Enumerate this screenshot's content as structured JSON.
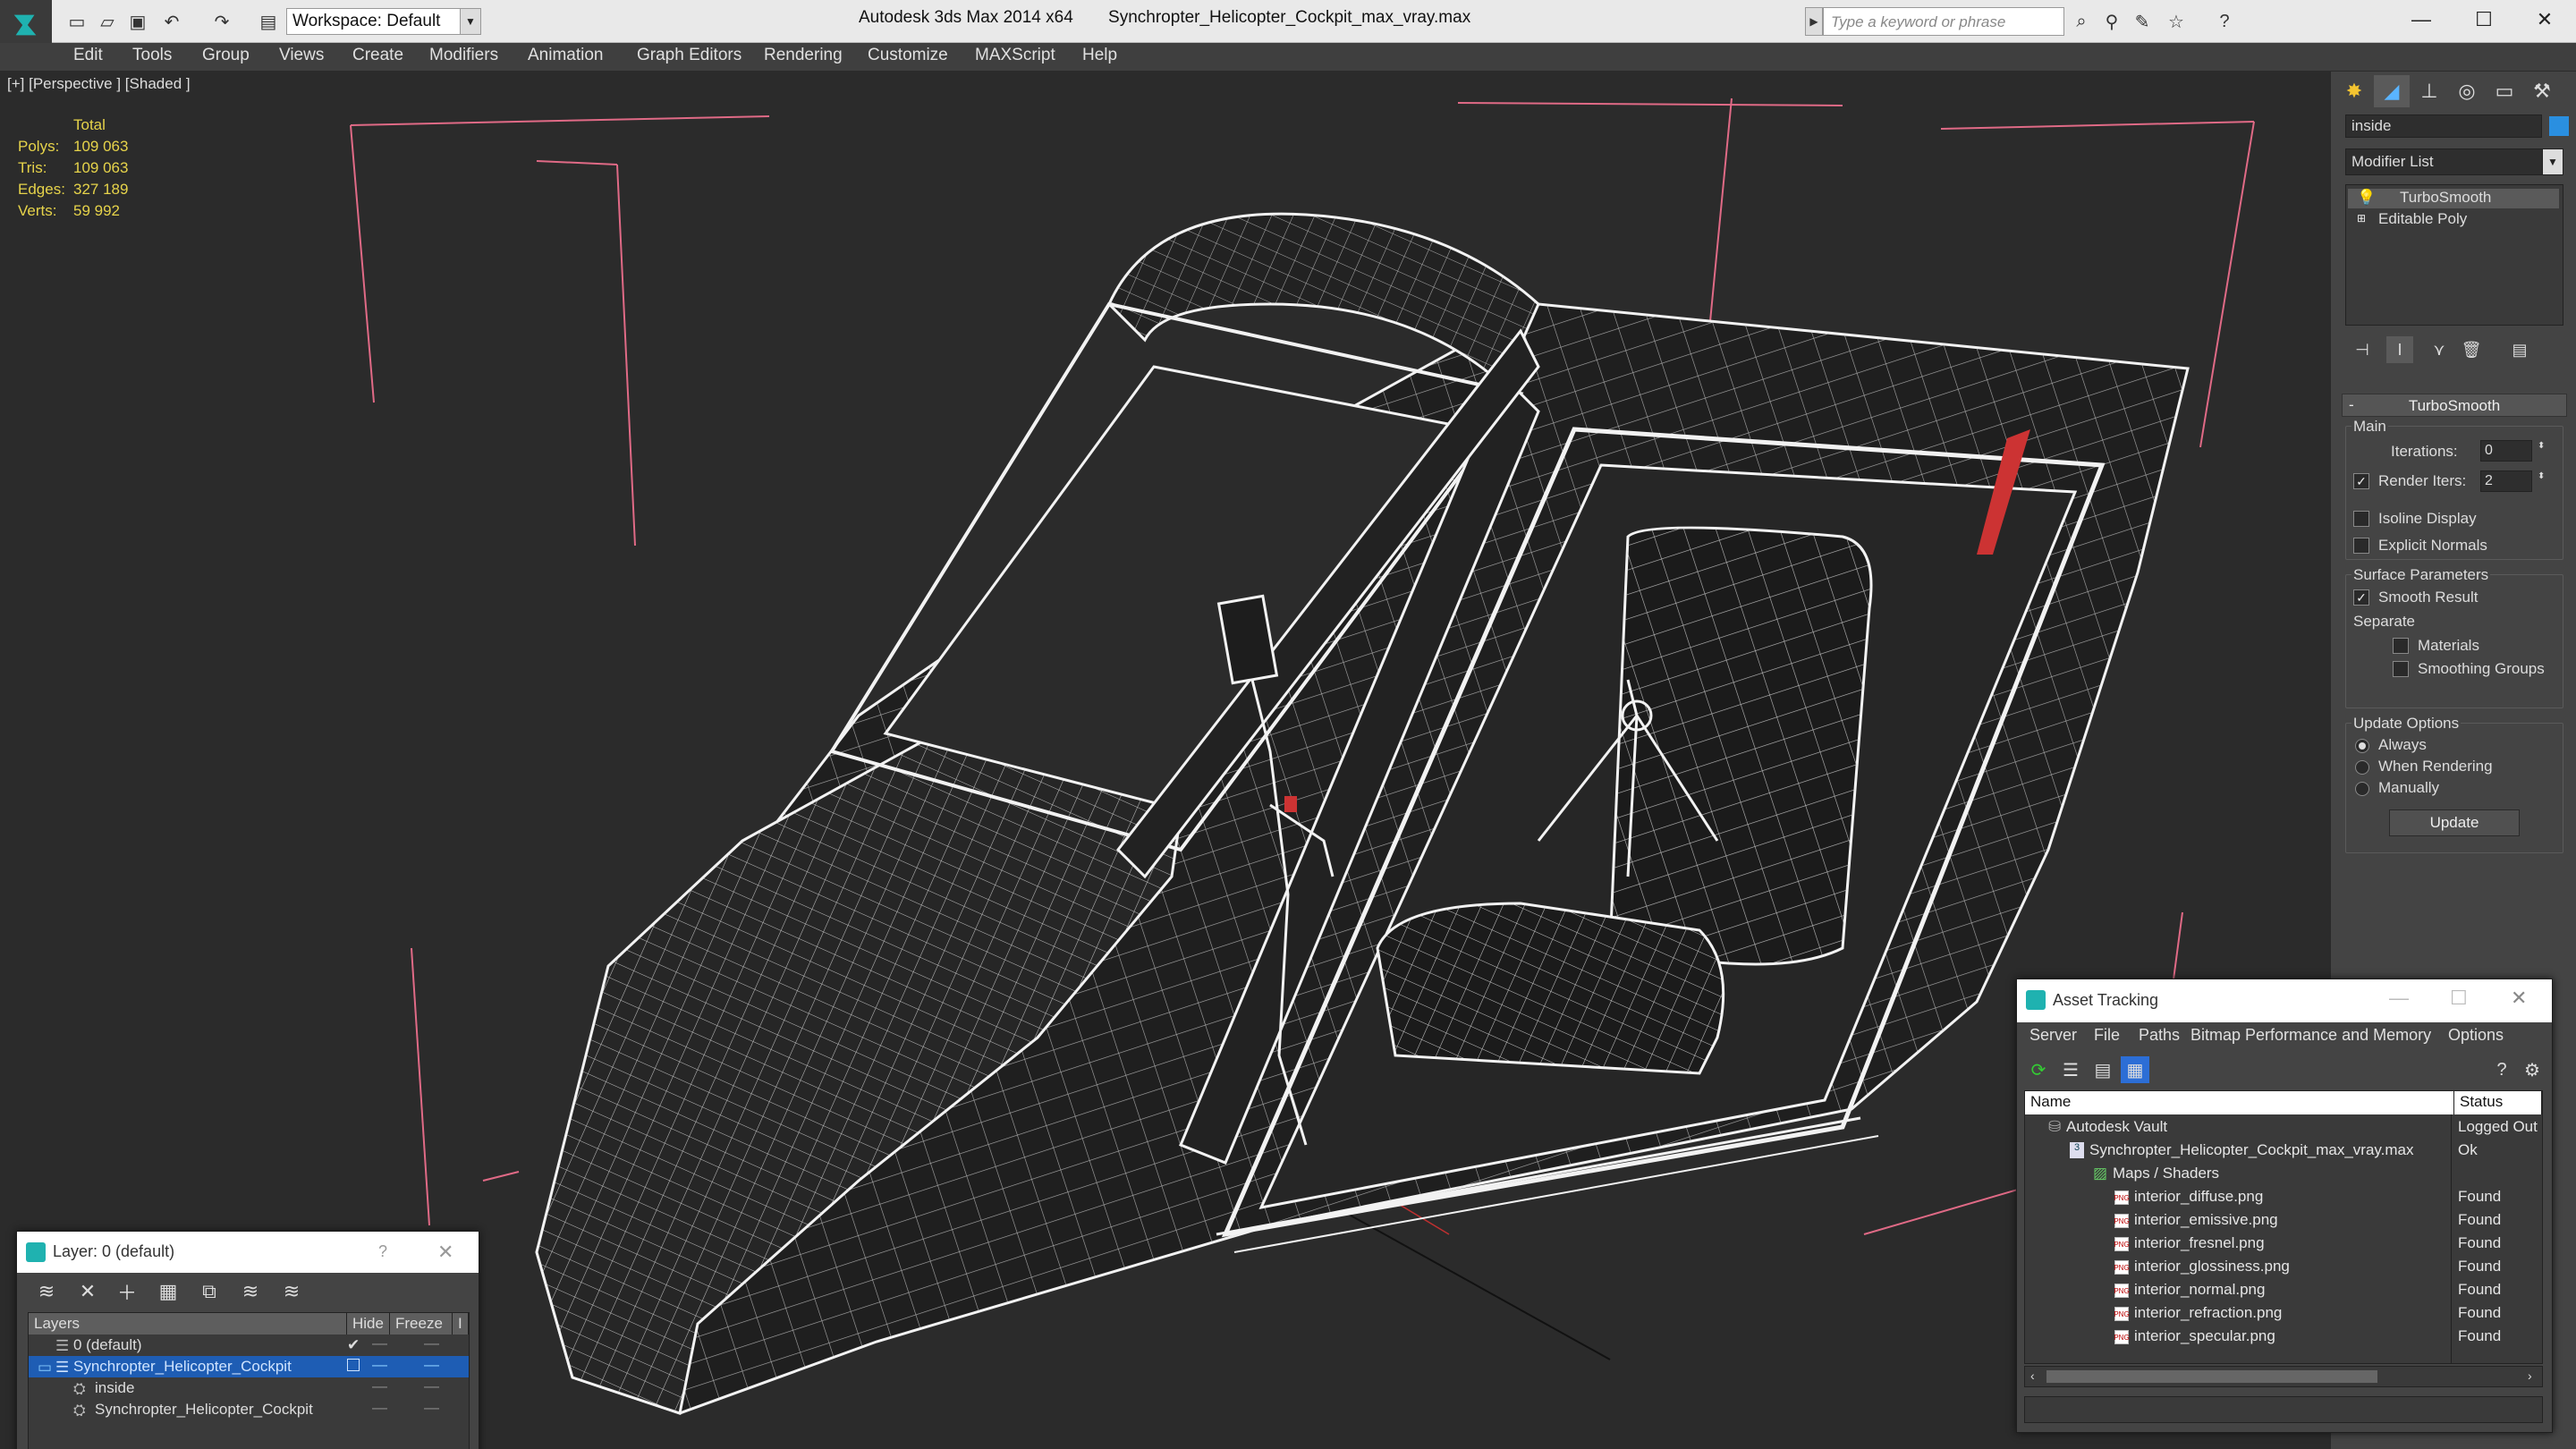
{
  "titlebar": {
    "workspace": "Workspace: Default",
    "app_title": "Autodesk 3ds Max  2014 x64",
    "file_title": "Synchropter_Helicopter_Cockpit_max_vray.max",
    "search_placeholder": "Type a keyword or phrase"
  },
  "menu": [
    "Edit",
    "Tools",
    "Group",
    "Views",
    "Create",
    "Modifiers",
    "Animation",
    "Graph Editors",
    "Rendering",
    "Customize",
    "MAXScript",
    "Help"
  ],
  "viewport": {
    "label": "[+] [Perspective ] [Shaded ]",
    "stats": {
      "header": "Total",
      "rows": [
        {
          "k": "Polys:",
          "v": "109 063"
        },
        {
          "k": "Tris:",
          "v": "109 063"
        },
        {
          "k": "Edges:",
          "v": "327 189"
        },
        {
          "k": "Verts:",
          "v": "59 992"
        }
      ]
    }
  },
  "command_panel": {
    "object_name": "inside",
    "modifier_list": "Modifier List",
    "stack": [
      "TurboSmooth",
      "Editable Poly"
    ],
    "turbosmooth": {
      "title": "TurboSmooth",
      "main": "Main",
      "iterations_label": "Iterations:",
      "iterations": "0",
      "render_iters_label": "Render Iters:",
      "render_iters": "2",
      "isoline": "Isoline Display",
      "explicit_normals": "Explicit Normals",
      "surface_params": "Surface Parameters",
      "smooth_result": "Smooth Result",
      "separate": "Separate",
      "materials": "Materials",
      "smoothing_groups": "Smoothing Groups",
      "update_options": "Update Options",
      "always": "Always",
      "when_rendering": "When Rendering",
      "manually": "Manually",
      "update": "Update"
    }
  },
  "layer_dialog": {
    "title": "Layer: 0 (default)",
    "help": "?",
    "columns": [
      "Layers",
      "Hide",
      "Freeze",
      "I"
    ],
    "rows": [
      "0 (default)",
      "Synchropter_Helicopter_Cockpit",
      "inside",
      "Synchropter_Helicopter_Cockpit"
    ]
  },
  "asset_dialog": {
    "title": "Asset Tracking",
    "menu": [
      "Server",
      "File",
      "Paths",
      "Bitmap Performance and Memory",
      "Options"
    ],
    "columns": [
      "Name",
      "Status"
    ],
    "rows": [
      {
        "name": "Autodesk Vault",
        "status": "Logged Out"
      },
      {
        "name": "Synchropter_Helicopter_Cockpit_max_vray.max",
        "status": "Ok"
      },
      {
        "name": "Maps / Shaders",
        "status": ""
      },
      {
        "name": "interior_diffuse.png",
        "status": "Found"
      },
      {
        "name": "interior_emissive.png",
        "status": "Found"
      },
      {
        "name": "interior_fresnel.png",
        "status": "Found"
      },
      {
        "name": "interior_glossiness.png",
        "status": "Found"
      },
      {
        "name": "interior_normal.png",
        "status": "Found"
      },
      {
        "name": "interior_refraction.png",
        "status": "Found"
      },
      {
        "name": "interior_specular.png",
        "status": "Found"
      }
    ],
    "file_icon_text": "PNG"
  },
  "colors": {
    "accent": "#2a8fe0",
    "selection": "#1e5db4",
    "stats_text": "#e6d34a",
    "grid_line": "#e06a86",
    "wire": "#f2f2f2"
  }
}
